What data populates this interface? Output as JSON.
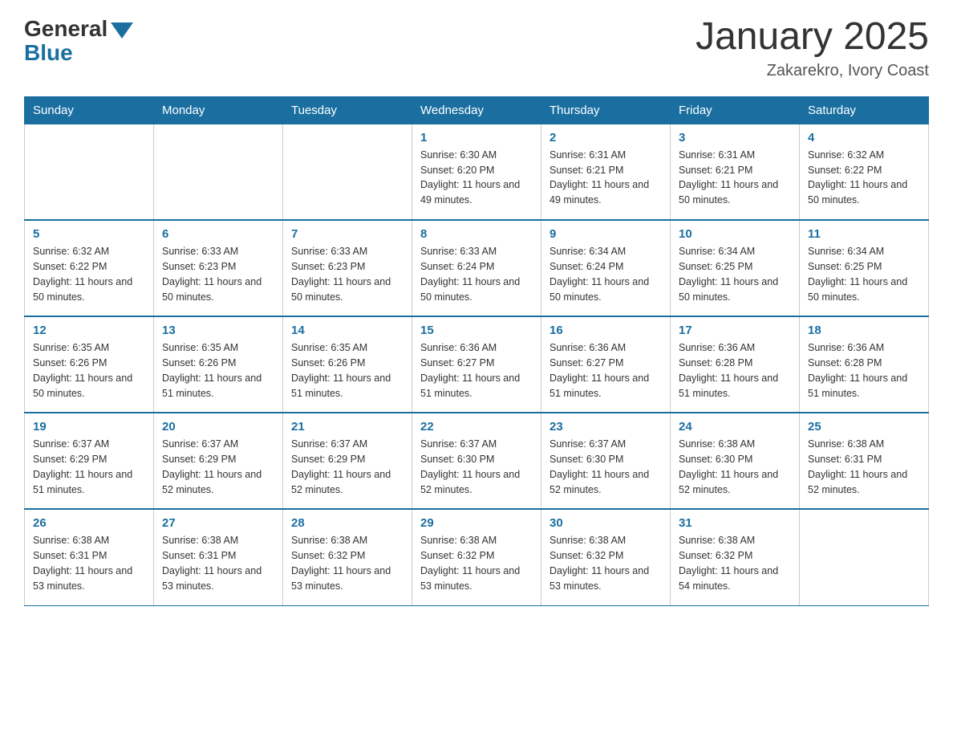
{
  "header": {
    "logo_general": "General",
    "logo_blue": "Blue",
    "main_title": "January 2025",
    "subtitle": "Zakarekro, Ivory Coast"
  },
  "days_of_week": [
    "Sunday",
    "Monday",
    "Tuesday",
    "Wednesday",
    "Thursday",
    "Friday",
    "Saturday"
  ],
  "weeks": [
    [
      {
        "day": "",
        "info": ""
      },
      {
        "day": "",
        "info": ""
      },
      {
        "day": "",
        "info": ""
      },
      {
        "day": "1",
        "info": "Sunrise: 6:30 AM\nSunset: 6:20 PM\nDaylight: 11 hours and 49 minutes."
      },
      {
        "day": "2",
        "info": "Sunrise: 6:31 AM\nSunset: 6:21 PM\nDaylight: 11 hours and 49 minutes."
      },
      {
        "day": "3",
        "info": "Sunrise: 6:31 AM\nSunset: 6:21 PM\nDaylight: 11 hours and 50 minutes."
      },
      {
        "day": "4",
        "info": "Sunrise: 6:32 AM\nSunset: 6:22 PM\nDaylight: 11 hours and 50 minutes."
      }
    ],
    [
      {
        "day": "5",
        "info": "Sunrise: 6:32 AM\nSunset: 6:22 PM\nDaylight: 11 hours and 50 minutes."
      },
      {
        "day": "6",
        "info": "Sunrise: 6:33 AM\nSunset: 6:23 PM\nDaylight: 11 hours and 50 minutes."
      },
      {
        "day": "7",
        "info": "Sunrise: 6:33 AM\nSunset: 6:23 PM\nDaylight: 11 hours and 50 minutes."
      },
      {
        "day": "8",
        "info": "Sunrise: 6:33 AM\nSunset: 6:24 PM\nDaylight: 11 hours and 50 minutes."
      },
      {
        "day": "9",
        "info": "Sunrise: 6:34 AM\nSunset: 6:24 PM\nDaylight: 11 hours and 50 minutes."
      },
      {
        "day": "10",
        "info": "Sunrise: 6:34 AM\nSunset: 6:25 PM\nDaylight: 11 hours and 50 minutes."
      },
      {
        "day": "11",
        "info": "Sunrise: 6:34 AM\nSunset: 6:25 PM\nDaylight: 11 hours and 50 minutes."
      }
    ],
    [
      {
        "day": "12",
        "info": "Sunrise: 6:35 AM\nSunset: 6:26 PM\nDaylight: 11 hours and 50 minutes."
      },
      {
        "day": "13",
        "info": "Sunrise: 6:35 AM\nSunset: 6:26 PM\nDaylight: 11 hours and 51 minutes."
      },
      {
        "day": "14",
        "info": "Sunrise: 6:35 AM\nSunset: 6:26 PM\nDaylight: 11 hours and 51 minutes."
      },
      {
        "day": "15",
        "info": "Sunrise: 6:36 AM\nSunset: 6:27 PM\nDaylight: 11 hours and 51 minutes."
      },
      {
        "day": "16",
        "info": "Sunrise: 6:36 AM\nSunset: 6:27 PM\nDaylight: 11 hours and 51 minutes."
      },
      {
        "day": "17",
        "info": "Sunrise: 6:36 AM\nSunset: 6:28 PM\nDaylight: 11 hours and 51 minutes."
      },
      {
        "day": "18",
        "info": "Sunrise: 6:36 AM\nSunset: 6:28 PM\nDaylight: 11 hours and 51 minutes."
      }
    ],
    [
      {
        "day": "19",
        "info": "Sunrise: 6:37 AM\nSunset: 6:29 PM\nDaylight: 11 hours and 51 minutes."
      },
      {
        "day": "20",
        "info": "Sunrise: 6:37 AM\nSunset: 6:29 PM\nDaylight: 11 hours and 52 minutes."
      },
      {
        "day": "21",
        "info": "Sunrise: 6:37 AM\nSunset: 6:29 PM\nDaylight: 11 hours and 52 minutes."
      },
      {
        "day": "22",
        "info": "Sunrise: 6:37 AM\nSunset: 6:30 PM\nDaylight: 11 hours and 52 minutes."
      },
      {
        "day": "23",
        "info": "Sunrise: 6:37 AM\nSunset: 6:30 PM\nDaylight: 11 hours and 52 minutes."
      },
      {
        "day": "24",
        "info": "Sunrise: 6:38 AM\nSunset: 6:30 PM\nDaylight: 11 hours and 52 minutes."
      },
      {
        "day": "25",
        "info": "Sunrise: 6:38 AM\nSunset: 6:31 PM\nDaylight: 11 hours and 52 minutes."
      }
    ],
    [
      {
        "day": "26",
        "info": "Sunrise: 6:38 AM\nSunset: 6:31 PM\nDaylight: 11 hours and 53 minutes."
      },
      {
        "day": "27",
        "info": "Sunrise: 6:38 AM\nSunset: 6:31 PM\nDaylight: 11 hours and 53 minutes."
      },
      {
        "day": "28",
        "info": "Sunrise: 6:38 AM\nSunset: 6:32 PM\nDaylight: 11 hours and 53 minutes."
      },
      {
        "day": "29",
        "info": "Sunrise: 6:38 AM\nSunset: 6:32 PM\nDaylight: 11 hours and 53 minutes."
      },
      {
        "day": "30",
        "info": "Sunrise: 6:38 AM\nSunset: 6:32 PM\nDaylight: 11 hours and 53 minutes."
      },
      {
        "day": "31",
        "info": "Sunrise: 6:38 AM\nSunset: 6:32 PM\nDaylight: 11 hours and 54 minutes."
      },
      {
        "day": "",
        "info": ""
      }
    ]
  ]
}
